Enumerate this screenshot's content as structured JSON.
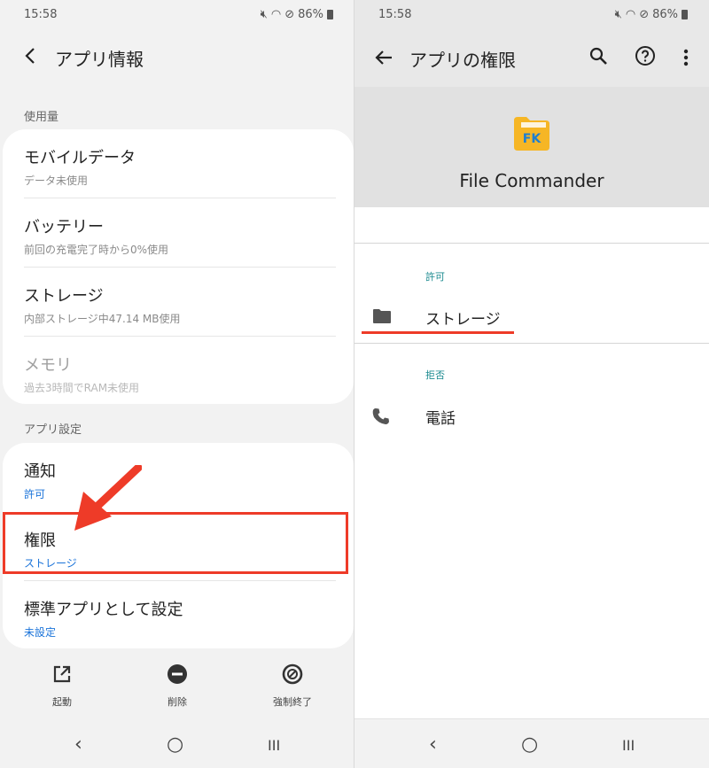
{
  "status": {
    "time": "15:58",
    "battery": "86%"
  },
  "left": {
    "title": "アプリ情報",
    "usage_label": "使用量",
    "usage_items": [
      {
        "title": "モバイルデータ",
        "subtitle": "データ未使用"
      },
      {
        "title": "バッテリー",
        "subtitle": "前回の充電完了時から0%使用"
      },
      {
        "title": "ストレージ",
        "subtitle": "内部ストレージ中47.14 MB使用"
      },
      {
        "title": "メモリ",
        "subtitle": "過去3時間でRAM未使用"
      }
    ],
    "settings_label": "アプリ設定",
    "settings_items": [
      {
        "title": "通知",
        "subtitle": "許可"
      },
      {
        "title": "権限",
        "subtitle": "ストレージ"
      },
      {
        "title": "標準アプリとして設定",
        "subtitle": "未設定"
      }
    ],
    "actions": [
      {
        "label": "起動",
        "icon": "open-external-icon"
      },
      {
        "label": "削除",
        "icon": "minus-circle-icon"
      },
      {
        "label": "強制終了",
        "icon": "block-icon"
      }
    ],
    "nav": {
      "recent": "III",
      "home": "○",
      "back": "‹"
    }
  },
  "right": {
    "title": "アプリの権限",
    "app_name": "File Commander",
    "app_icon_text": "FK",
    "colors": {
      "folder": "#f6b625",
      "folder_text": "#1e7fd0",
      "accent": "#1b8a8f",
      "highlight": "#ee3b28"
    },
    "allowed_label": "許可",
    "allowed": [
      {
        "label": "ストレージ",
        "icon": "folder-icon"
      }
    ],
    "denied_label": "拒否",
    "denied": [
      {
        "label": "電話",
        "icon": "phone-icon"
      }
    ]
  }
}
